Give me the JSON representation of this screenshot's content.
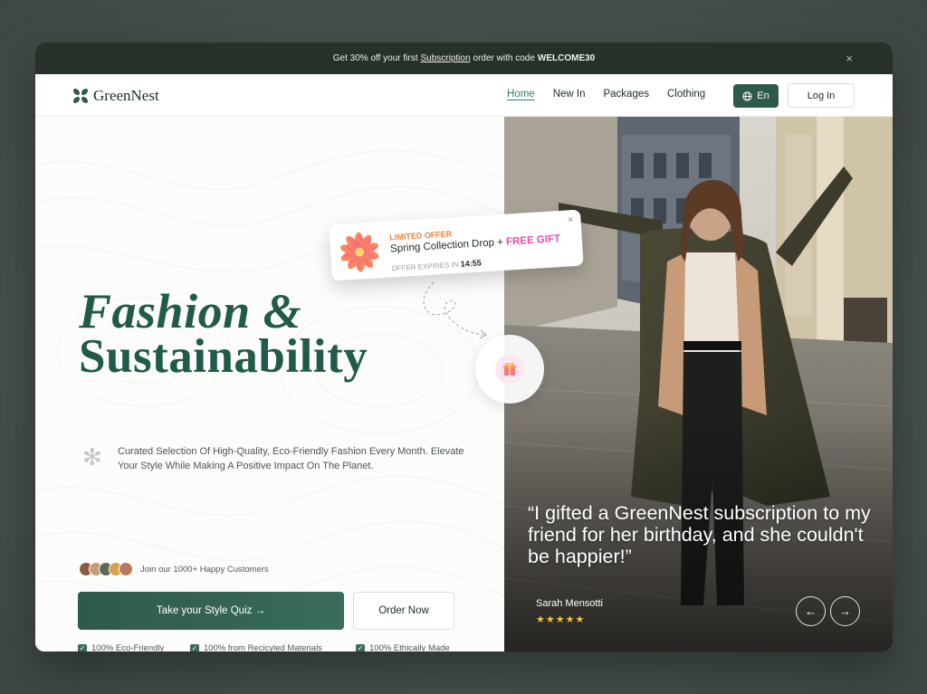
{
  "promo": {
    "text_before": "Get 30% off your first",
    "link": "Subscription",
    "text_after": "order with code",
    "code": "WELCOME30",
    "close": "×"
  },
  "header": {
    "brand": "GreenNest",
    "nav": [
      {
        "label": "Home",
        "active": true
      },
      {
        "label": "New In",
        "active": false
      },
      {
        "label": "Packages",
        "active": false
      },
      {
        "label": "Clothing",
        "active": false
      }
    ],
    "language": "En",
    "login": "Log In"
  },
  "hero": {
    "title_line1": "Fashion &",
    "title_line2": "Sustainability",
    "description": "Curated Selection Of High-Quality, Eco-Friendly Fashion Every Month. Elevate Your Style While Making A Positive Impact On The Planet.",
    "customers_text": "Join our 1000+ Happy Customers",
    "avatar_colors": [
      "#8a5a44",
      "#c99a7a",
      "#5b6b58",
      "#d6a24a",
      "#b87a5a"
    ],
    "cta_primary": "Take your Style Quiz →",
    "cta_secondary": "Order Now",
    "features": [
      "100% Eco-Friendly",
      "100% from Recicyled Materials",
      "100% Ethically Made"
    ]
  },
  "offer": {
    "badge": "LIMITED OFFER",
    "title": "Spring Collection Drop +",
    "gift": "FREE GIFT",
    "expires_label": "OFFER EXPIRES IN",
    "expires_time": "14:55",
    "close": "×"
  },
  "testimonial": {
    "quote": "“I gifted a GreenNest subscription to my friend for her birthday, and she couldn't be happier!”",
    "name": "Sarah Mensotti",
    "stars": "★★★★★",
    "prev": "←",
    "next": "→"
  },
  "colors": {
    "brand_green": "#2e5a4c",
    "accent_green": "#2e7d68",
    "promo_bar": "#253129",
    "offer_orange": "#f57f3a",
    "offer_pink": "#e94ba7",
    "star_yellow": "#f5c242"
  }
}
